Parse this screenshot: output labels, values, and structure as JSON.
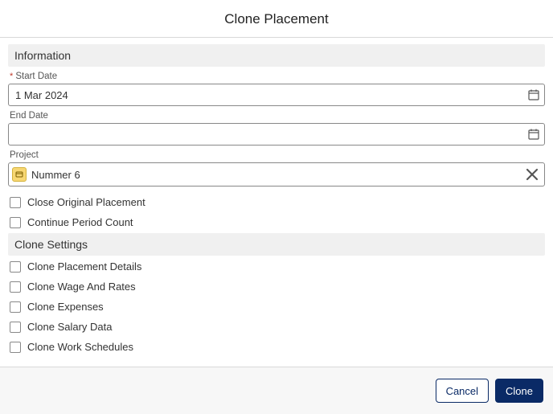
{
  "title": "Clone Placement",
  "sections": {
    "information": {
      "header": "Information",
      "start_date": {
        "label": "Start Date",
        "value": "1 Mar 2024",
        "required": true
      },
      "end_date": {
        "label": "End Date",
        "value": "",
        "required": false
      },
      "project": {
        "label": "Project",
        "value": "Nummer 6",
        "icon": "project-icon"
      },
      "checkboxes": [
        {
          "key": "close_original",
          "label": "Close Original Placement",
          "checked": false
        },
        {
          "key": "continue_period",
          "label": "Continue Period Count",
          "checked": false
        }
      ]
    },
    "clone_settings": {
      "header": "Clone Settings",
      "checkboxes": [
        {
          "key": "clone_details",
          "label": "Clone Placement Details",
          "checked": false
        },
        {
          "key": "clone_wage",
          "label": "Clone Wage And Rates",
          "checked": false
        },
        {
          "key": "clone_expenses",
          "label": "Clone Expenses",
          "checked": false
        },
        {
          "key": "clone_salary",
          "label": "Clone Salary Data",
          "checked": false
        },
        {
          "key": "clone_schedules",
          "label": "Clone Work Schedules",
          "checked": false
        }
      ]
    }
  },
  "footer": {
    "cancel": "Cancel",
    "clone": "Clone"
  }
}
